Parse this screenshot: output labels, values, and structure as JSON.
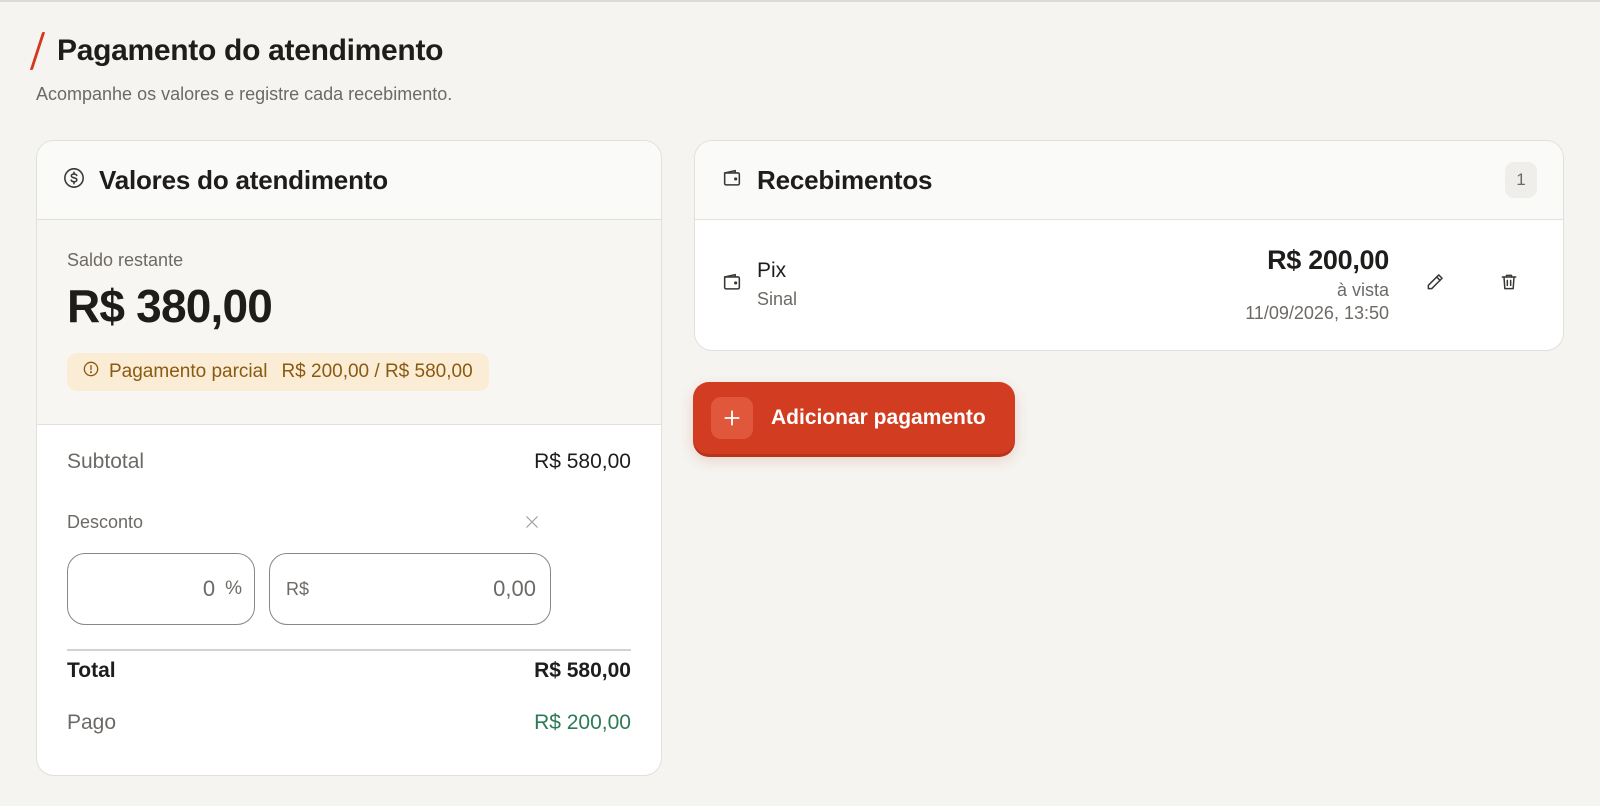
{
  "page": {
    "title": "Pagamento do atendimento",
    "subtitle": "Acompanhe os valores e registre cada recebimento."
  },
  "values_card": {
    "title": "Valores do atendimento",
    "icon": "dollar-circle-icon",
    "balance_label": "Saldo restante",
    "balance_value": "R$ 380,00",
    "partial_badge": {
      "label": "Pagamento parcial",
      "amount": "R$ 200,00 / R$ 580,00",
      "icon": "alert-circle-icon"
    },
    "subtotal_label": "Subtotal",
    "subtotal_value": "R$ 580,00",
    "discount_label": "Desconto",
    "discount_percent_value": "0",
    "discount_percent_unit": "%",
    "discount_money_prefix": "R$",
    "discount_money_value": "0,00",
    "total_label": "Total",
    "total_value": "R$ 580,00",
    "paid_label": "Pago",
    "paid_value": "R$ 200,00"
  },
  "receipts_card": {
    "title": "Recebimentos",
    "icon": "wallet-icon",
    "count": "1",
    "items": [
      {
        "method": "Pix",
        "type": "Sinal",
        "amount": "R$ 200,00",
        "terms": "à vista",
        "datetime": "11/09/2026, 13:50"
      }
    ]
  },
  "actions": {
    "add_payment_label": "Adicionar pagamento"
  },
  "colors": {
    "accent": "#d23d22",
    "paid_green": "#2e7a56",
    "warning_bg": "#fbecd6",
    "warning_text": "#8a5a10"
  }
}
